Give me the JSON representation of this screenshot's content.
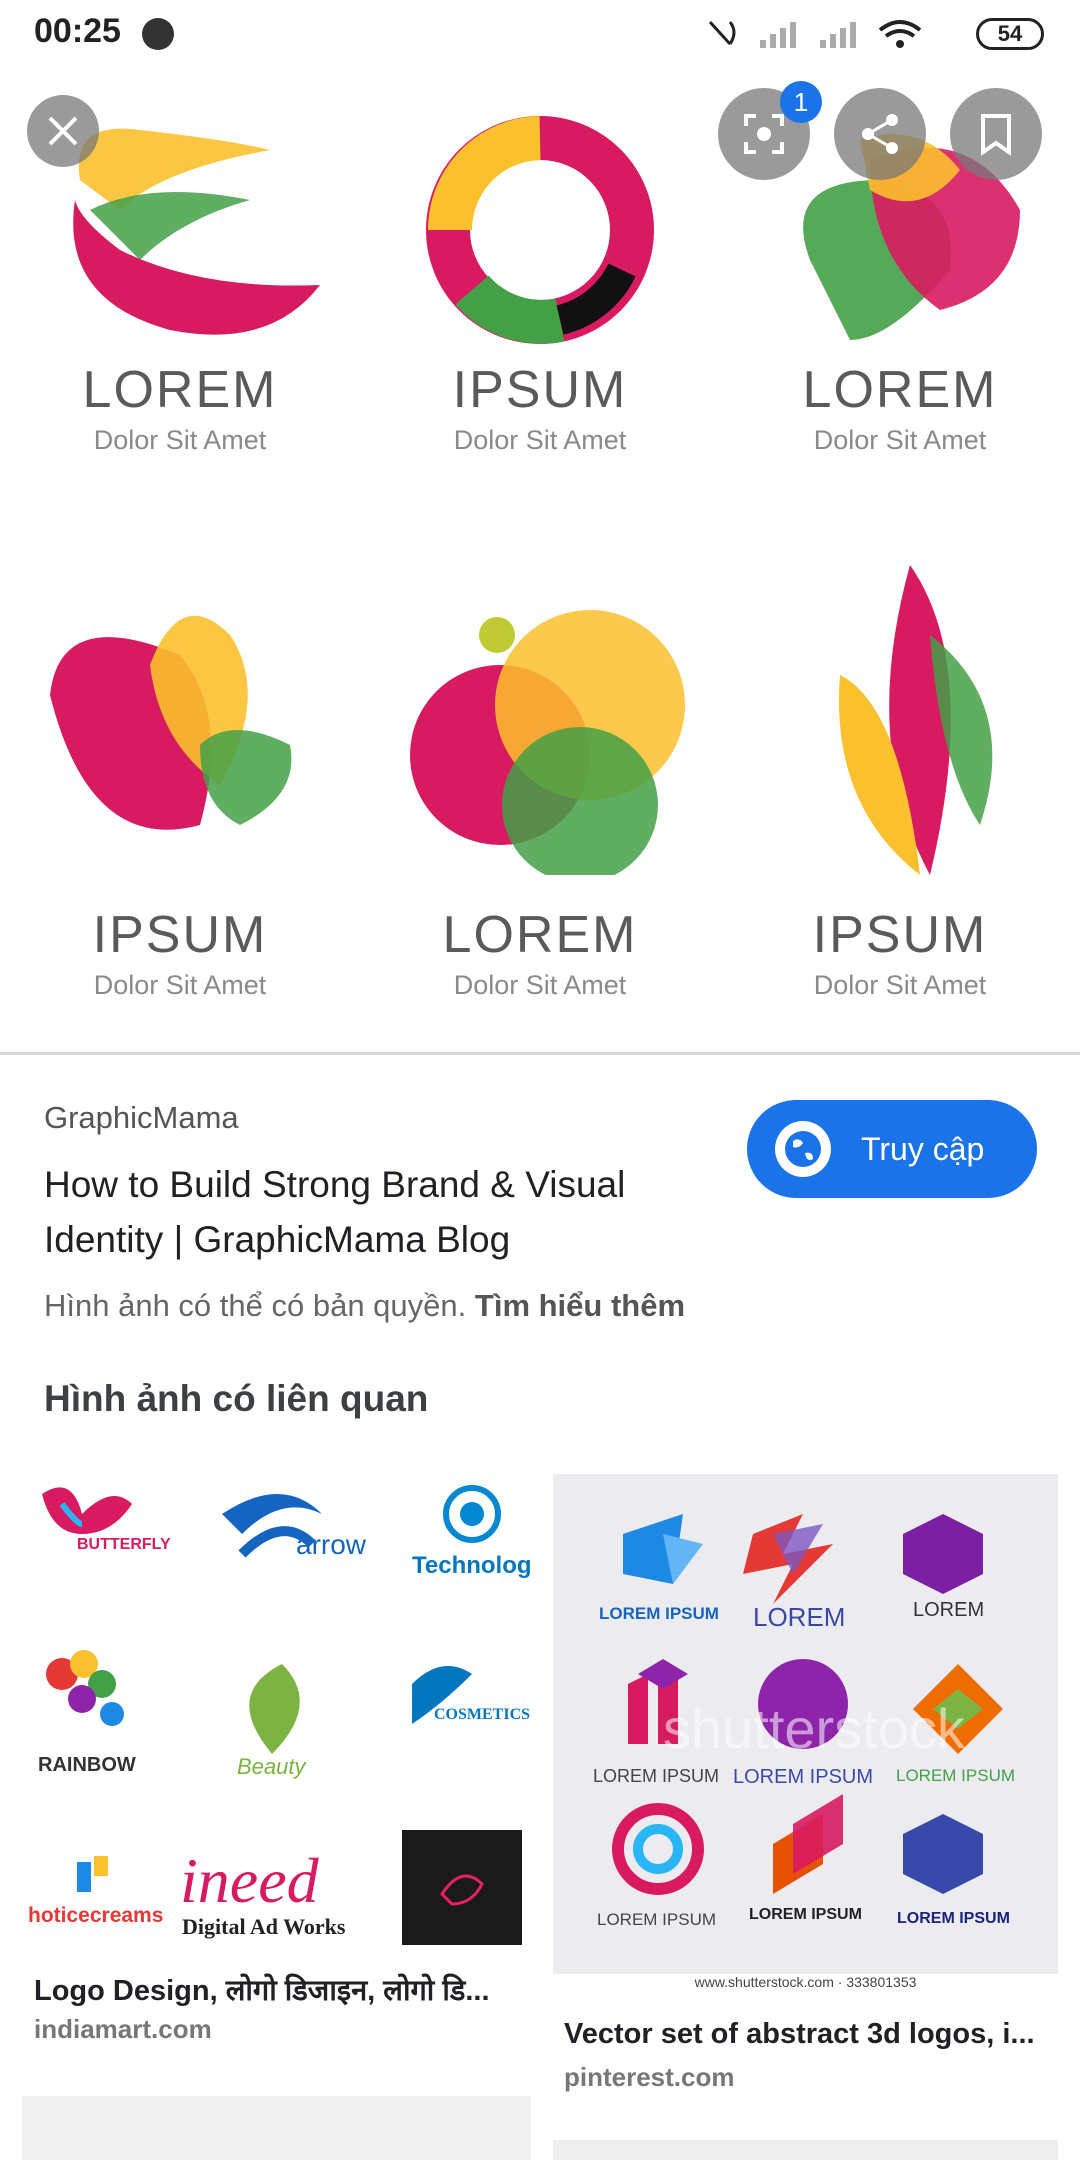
{
  "status_bar": {
    "time": "00:25",
    "battery": "54"
  },
  "viewer": {
    "lens_badge": "1",
    "logos": [
      {
        "word": "LOREM",
        "sub": "Dolor Sit Amet"
      },
      {
        "word": "IPSUM",
        "sub": "Dolor Sit Amet"
      },
      {
        "word": "LOREM",
        "sub": "Dolor Sit Amet"
      },
      {
        "word": "IPSUM",
        "sub": "Dolor Sit Amet"
      },
      {
        "word": "LOREM",
        "sub": "Dolor Sit Amet"
      },
      {
        "word": "IPSUM",
        "sub": "Dolor Sit Amet"
      }
    ]
  },
  "result": {
    "source": "GraphicMama",
    "title": "How to Build Strong Brand & Visual Identity | GraphicMama Blog",
    "visit_label": "Truy cập",
    "copyright_text": "Hình ảnh có thể có bản quyền.",
    "learn_more": "Tìm hiểu thêm"
  },
  "related": {
    "heading": "Hình ảnh có liên quan",
    "cards": [
      {
        "title": "Logo Design, लोगो डिजाइन, लोगो डि...",
        "domain": "indiamart.com",
        "logos": [
          "BUTTERFLY",
          "arrow",
          "Technology",
          "RAINBOW",
          "Beauty",
          "COSMETICS",
          "hoticecreams",
          "ineed",
          "Digital Ad Works"
        ]
      },
      {
        "title": "Vector set of abstract 3d logos, i...",
        "domain": "pinterest.com",
        "logos": [
          "LOREM IPSUM",
          "LOREM",
          "LOREM",
          "LOREM IPSUM",
          "LOREM IPSUM",
          "LOREM IPSUM",
          "LOREM IPSUM",
          "LOREM IPSUM",
          "LOREM IPSUM"
        ],
        "watermark": "shutterstock",
        "footer": "www.shutterstock.com · 333801353"
      }
    ]
  },
  "colors": {
    "accent": "#1a73e8",
    "magenta": "#d81b60",
    "yellow": "#fbc02d",
    "green": "#43a047"
  }
}
